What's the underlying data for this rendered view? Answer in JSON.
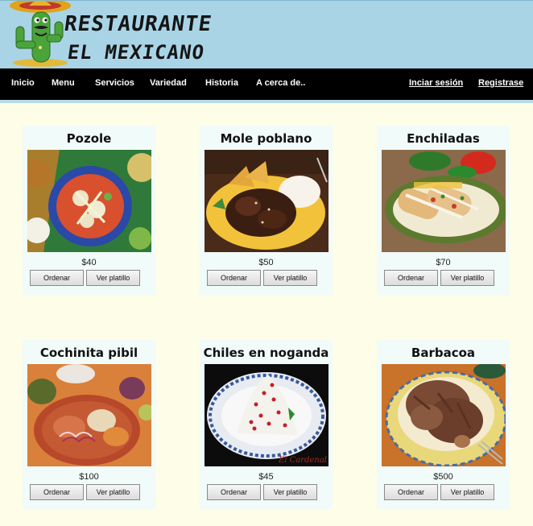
{
  "brand": {
    "line1": "RESTAURANTE",
    "line2": "EL MEXICANO"
  },
  "nav": {
    "left": [
      "Inicio",
      "Menu",
      "Servicios",
      "Variedad",
      "Historia",
      "A cerca de.."
    ],
    "right": [
      "Inciar sesión",
      "Registrase"
    ]
  },
  "cards": [
    {
      "title": "Pozole",
      "price": "$40",
      "order": "Ordenar",
      "view": "Ver platillo"
    },
    {
      "title": "Mole poblano",
      "price": "$50",
      "order": "Ordenar",
      "view": "Ver platillo"
    },
    {
      "title": "Enchiladas",
      "price": "$70",
      "order": "Ordenar",
      "view": "Ver platillo"
    },
    {
      "title": "Cochinita pibil",
      "price": "$100",
      "order": "Ordenar",
      "view": "Ver platillo"
    },
    {
      "title": "Chiles en noganda",
      "price": "$45",
      "order": "Ordenar",
      "view": "Ver platillo",
      "watermark": "El Cardenal"
    },
    {
      "title": "Barbacoa",
      "price": "$500",
      "order": "Ordenar",
      "view": "Ver platillo"
    }
  ],
  "colors": {
    "header_bg": "#a9d4e6",
    "nav_bg": "#000000",
    "page_bg": "#fdfde8",
    "card_bg": "#f1fbf9"
  }
}
